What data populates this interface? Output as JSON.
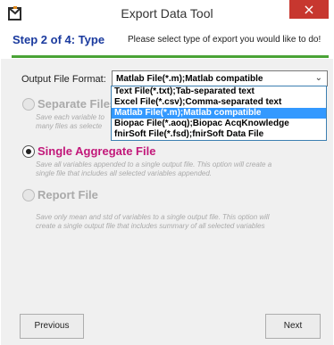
{
  "window": {
    "title": "Export Data Tool",
    "close_label": "×",
    "icon": "app-logo-icon"
  },
  "header": {
    "step": "Step 2 of 4: Type",
    "instruction": "Please select type of export you would like to do!"
  },
  "format": {
    "label": "Output File Format:",
    "selected": "Matlab File(*.m);Matlab compatible",
    "options": [
      "Text File(*.txt);Tab-separated text",
      "Excel File(*.csv);Comma-separated text",
      "Matlab File(*.m);Matlab compatible",
      "Biopac File(*.aoq);Biopac AcqKnowledge",
      "fnirSoft File(*.fsd);fnirSoft Data File"
    ]
  },
  "options": {
    "separate": {
      "label": "Separate Files",
      "desc_1": "Save each variable to",
      "desc_2": "many files as selecte"
    },
    "aggregate": {
      "label": "Single Aggregate File",
      "desc_1": "Save all variables appended to a single output file. This option will create a",
      "desc_2": "single file that includes all selected variables appended."
    },
    "report": {
      "label": "Report File",
      "desc_1": "Save only mean and std of variables to a single output file. This option will",
      "desc_2": "create a single output file that includes summary of all selected variables"
    }
  },
  "buttons": {
    "previous": "Previous",
    "next": "Next"
  },
  "colors": {
    "accent_green": "#4aa336",
    "step_blue": "#1a3a9e",
    "selected_option": "#c2187a",
    "close_red": "#c7372f",
    "highlight": "#3399ff"
  }
}
